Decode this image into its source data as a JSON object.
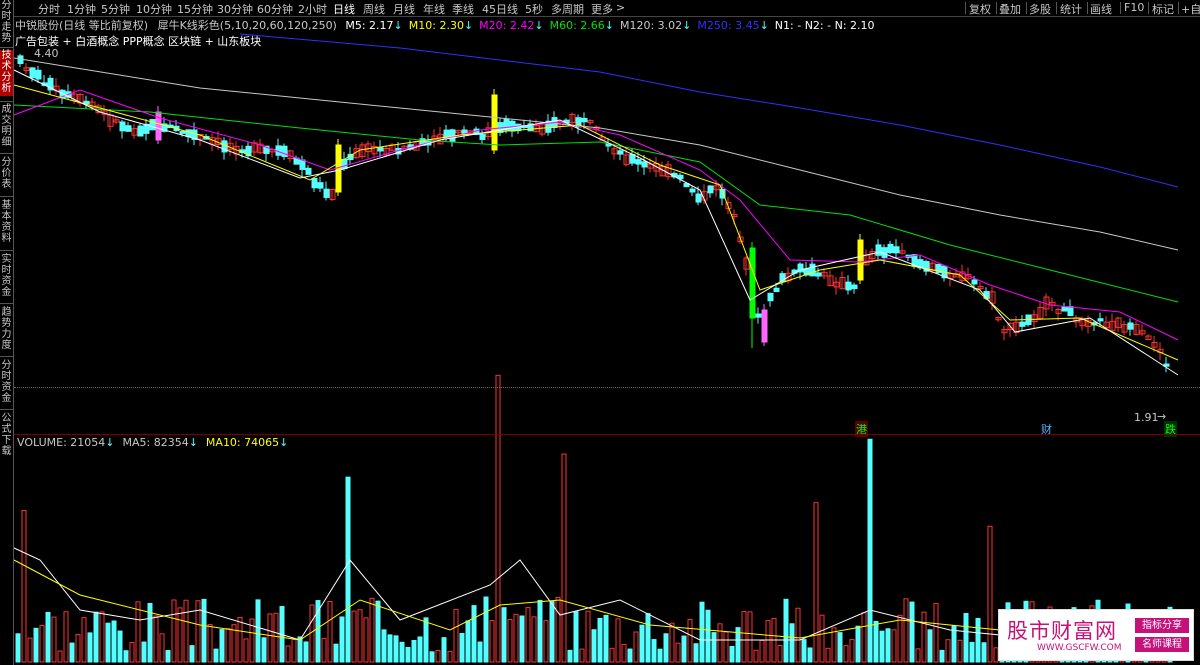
{
  "sidebar": {
    "tabs": [
      {
        "label": "分时走势",
        "active": false
      },
      {
        "label": "技术分析",
        "active": true
      },
      {
        "label": "成交明细",
        "active": false
      },
      {
        "label": "分价表",
        "active": false
      },
      {
        "label": "基本资料",
        "active": false
      },
      {
        "label": "实时资金",
        "active": false
      },
      {
        "label": "趋势力度",
        "active": false
      },
      {
        "label": "分时资金",
        "active": false
      },
      {
        "label": "公式下载",
        "active": false
      }
    ]
  },
  "toolbar": {
    "periods": [
      "分时",
      "1分钟",
      "5分钟",
      "10分钟",
      "15分钟",
      "30分钟",
      "60分钟",
      "2小时",
      "日线",
      "周线",
      "月线",
      "年线",
      "季线",
      "45日线",
      "5秒",
      "多周期",
      "更多"
    ],
    "active_period": "日线",
    "more_arrow": ">",
    "right_buttons": [
      "复权",
      "叠加",
      "多股",
      "统计",
      "画线",
      "F10",
      "标记",
      "+自"
    ]
  },
  "chart_info": {
    "stock": "中锐股份(日线 等比前复权)",
    "indicator": "犀牛K线彩色(5,10,20,60,120,250)",
    "ma": [
      {
        "label": "M5: 2.17",
        "arrow": "↓",
        "color": "#ffffff"
      },
      {
        "label": "M10: 2.30",
        "arrow": "↓",
        "color": "#ffff00"
      },
      {
        "label": "M20: 2.42",
        "arrow": "↓",
        "color": "#ff00ff"
      },
      {
        "label": "M60: 2.66",
        "arrow": "↓",
        "color": "#00e000"
      },
      {
        "label": "M120: 3.02",
        "arrow": "↓",
        "color": "#c8c8c8"
      },
      {
        "label": "M250: 3.45",
        "arrow": "↓",
        "color": "#3030ff"
      }
    ],
    "extra": "N1: -  N2: -  N: 2.10",
    "concepts": "广告包装 + 白酒概念 PPP概念 区块链 + 山东板块"
  },
  "price_labels": {
    "high": "4.40",
    "low": "1.91"
  },
  "event_tags": [
    {
      "text": "港",
      "color": "#00ff00"
    },
    {
      "text": "财",
      "color": "#5ab0ff"
    },
    {
      "text": "跌",
      "color": "#00ff00"
    }
  ],
  "volume_info": {
    "volume": "VOLUME: 21054",
    "ma5": "MA5: 82354",
    "ma10": "MA10: 74065",
    "arrow": "↓",
    "colors": {
      "volume": "#c8c8c8",
      "ma5": "#c8c8c8",
      "ma10": "#ffff00"
    }
  },
  "watermark": {
    "title": "股市财富网",
    "url": "WWW.GSCFW.COM",
    "badge1": "指标分享",
    "badge2": "名师课程"
  },
  "colors": {
    "up": "#ff3232",
    "down": "#54ffff",
    "breakout": "#ffff00",
    "bull_up": "#00ff00",
    "bear": "#ff66ff",
    "ma5": "#ffffff",
    "ma10": "#ffff00",
    "ma20": "#ff00ff",
    "ma60": "#00e000",
    "ma120": "#c8c8c8",
    "ma250": "#3030ff"
  }
}
